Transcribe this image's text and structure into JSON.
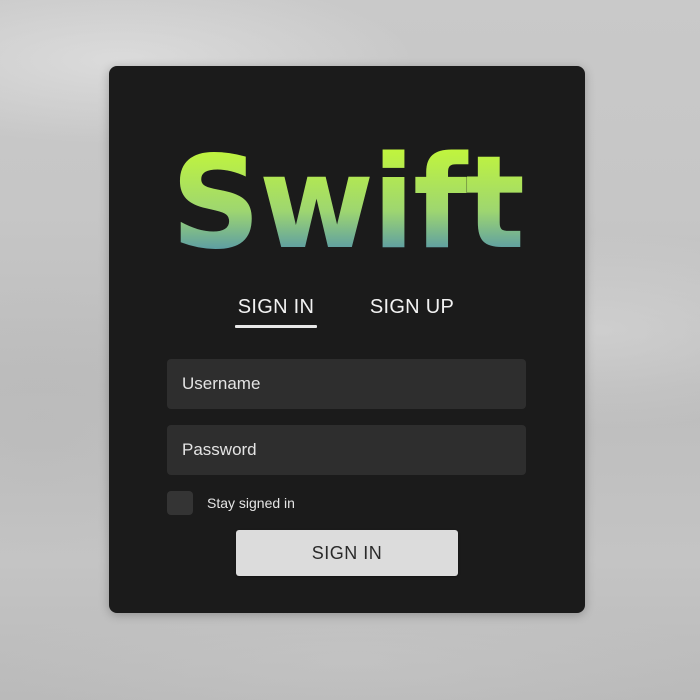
{
  "brand": {
    "logo_text": "Swift",
    "gradient_top": "#c8ff2e",
    "gradient_mid": "#9fd86a",
    "gradient_bottom": "#2e77c8"
  },
  "tabs": [
    {
      "label": "SIGN IN",
      "active": true
    },
    {
      "label": "SIGN UP",
      "active": false
    }
  ],
  "form": {
    "username": {
      "placeholder": "Username",
      "value": ""
    },
    "password": {
      "placeholder": "Password",
      "value": ""
    },
    "stay_signed_in": {
      "label": "Stay signed in",
      "checked": false
    },
    "submit_label": "SIGN IN"
  },
  "colors": {
    "card_bg": "#1b1b1b",
    "field_bg": "#2e2e2e",
    "button_bg": "#dcdcdc"
  }
}
